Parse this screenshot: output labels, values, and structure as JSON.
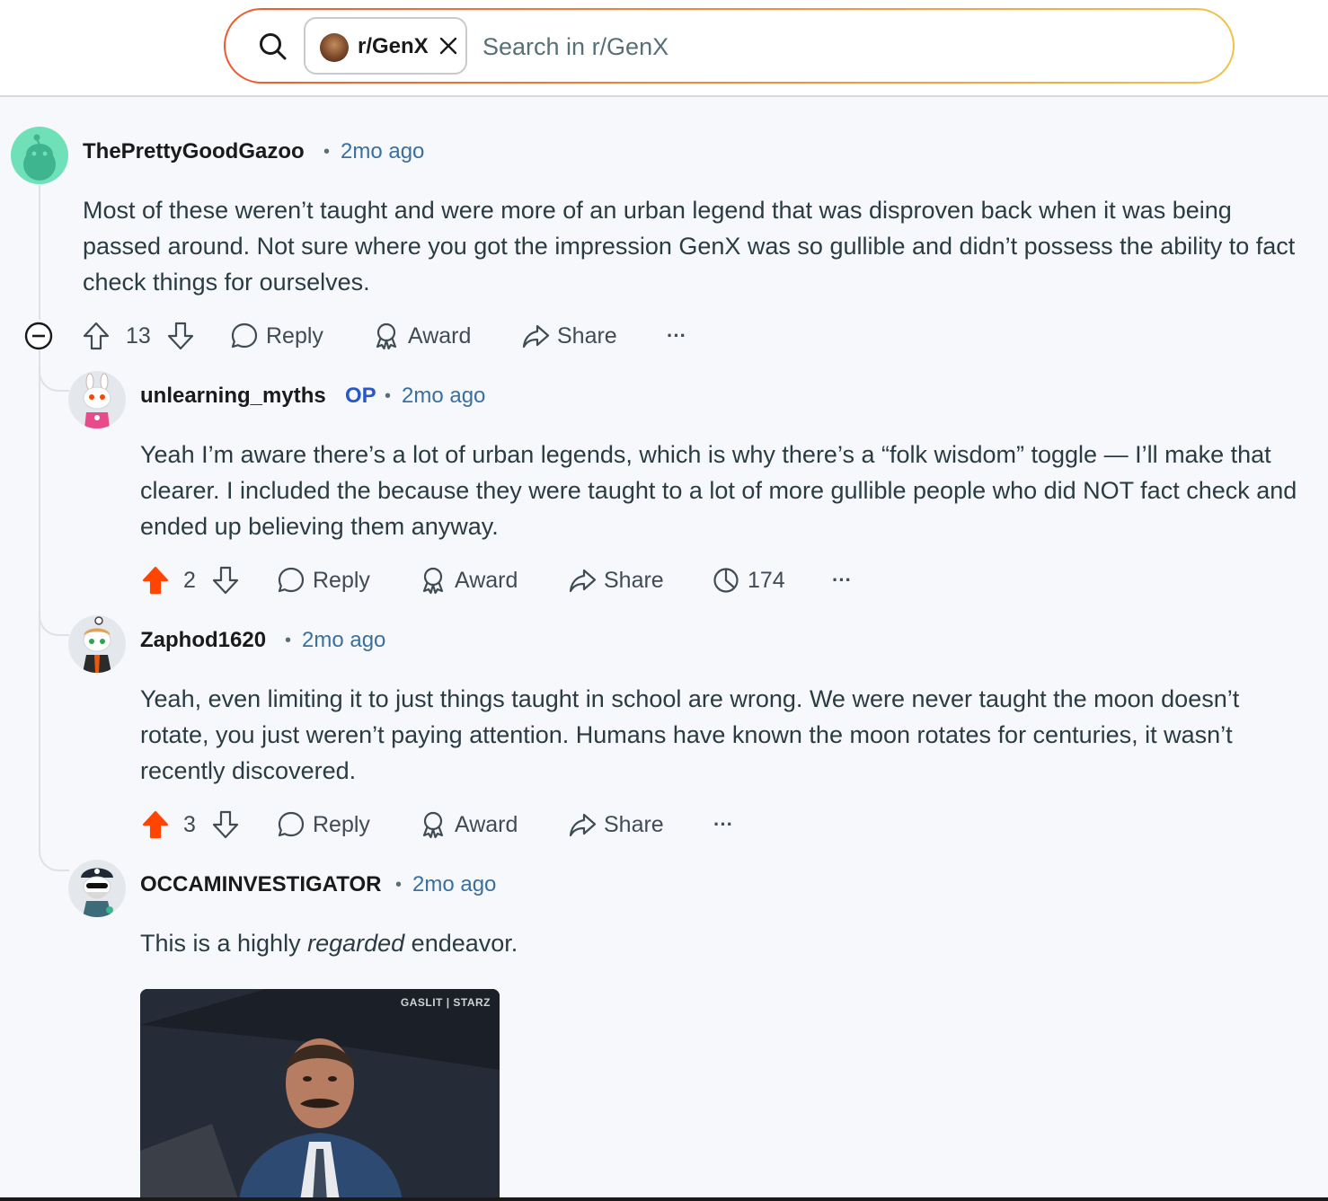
{
  "search": {
    "chip_label": "r/GenX",
    "placeholder": "Search in r/GenX"
  },
  "comments": [
    {
      "username": "ThePrettyGoodGazoo",
      "time": "2mo ago",
      "body": "Most of these weren’t taught and were more of an urban legend that was disproven back when it was being passed around. Not sure where you got the impression GenX was so gullible and didn’t possess the ability to fact check things for ourselves.",
      "votes": "13",
      "reply_label": "Reply",
      "award_label": "Award",
      "share_label": "Share",
      "more_label": "···"
    },
    {
      "username": "unlearning_myths",
      "op_badge": "OP",
      "time": "2mo ago",
      "body": "Yeah I’m aware there’s a lot of urban legends, which is why there’s a “folk wisdom” toggle — I’ll make that clearer. I included the because they were taught to a lot of more gullible people who did NOT fact check and ended up believing them anyway.",
      "votes": "2",
      "reply_label": "Reply",
      "award_label": "Award",
      "share_label": "Share",
      "insights_count": "174",
      "more_label": "···"
    },
    {
      "username": "Zaphod1620",
      "time": "2mo ago",
      "body": "Yeah, even limiting it to just things taught in school are wrong. We were never taught the moon doesn’t rotate, you just weren’t paying attention. Humans have known the moon rotates for centuries, it wasn’t recently discovered.",
      "votes": "3",
      "reply_label": "Reply",
      "award_label": "Award",
      "share_label": "Share",
      "more_label": "···"
    },
    {
      "username": "OCCAMINVESTIGATOR",
      "time": "2mo ago",
      "body_before": "This is a highly ",
      "body_em": "regarded",
      "body_after": " endeavor.",
      "gif_watermark": "GASLIT | STARZ"
    }
  ],
  "colors": {
    "upvote_active": "#ff4500",
    "time_link": "#3b6f9e",
    "op_badge": "#2a57c7",
    "search_gradient": [
      "#ee5a2f",
      "#f5c04d"
    ]
  }
}
